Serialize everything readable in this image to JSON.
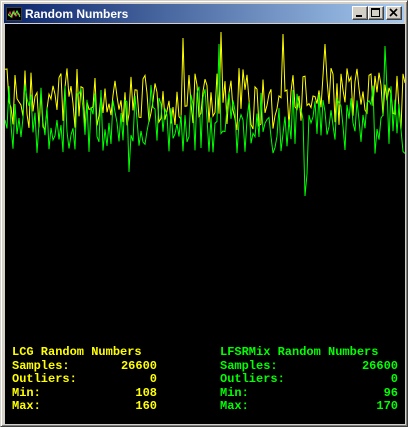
{
  "window": {
    "title": "Random Numbers",
    "buttons": {
      "minimize": "minimize-icon",
      "maximize": "maximize-icon",
      "close": "close-icon"
    }
  },
  "lcg": {
    "heading": "LCG Random Numbers",
    "color": "#ffff00",
    "rows": [
      {
        "label": "Samples:",
        "value": "26600"
      },
      {
        "label": "Outliers:",
        "value": "0"
      },
      {
        "label": "Min:",
        "value": "108"
      },
      {
        "label": "Max:",
        "value": "160"
      }
    ]
  },
  "lfsr": {
    "heading": "LFSRMix Random Numbers",
    "color": "#00ff00",
    "rows": [
      {
        "label": "Samples:",
        "value": "26600"
      },
      {
        "label": "Outliers:",
        "value": "0"
      },
      {
        "label": "Min:",
        "value": "96"
      },
      {
        "label": "Max:",
        "value": "170"
      }
    ]
  }
}
